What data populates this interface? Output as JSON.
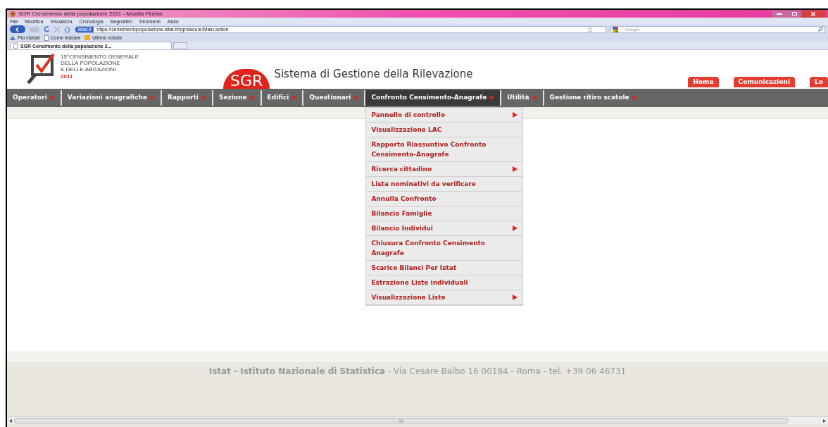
{
  "window": {
    "title": "SGR Censimento della popolazione 2011 - Mozilla Firefox"
  },
  "menu_bar": [
    "File",
    "Modifica",
    "Visualizza",
    "Cronologia",
    "Segnalibri",
    "Strumenti",
    "Aiuto"
  ],
  "address_bar": {
    "site_badge": "istat.it",
    "url": "https://censimentopopolazione.istat.it/sgr/secure/Main.action"
  },
  "search_field": {
    "placeholder": "Google"
  },
  "bookmarks": [
    "Più visitati",
    "Come iniziare",
    "Ultime notizie"
  ],
  "tabs": [
    {
      "label": "SGR Censimento della popolazione 2...",
      "selected": true
    }
  ],
  "header": {
    "logo_lines": [
      "15°CENSIMENTO GENERALE",
      "DELLA POPOLAZIONE",
      "E DELLE ABITAZIONI",
      "2011"
    ],
    "app_badge": "SGR",
    "app_title": "Sistema di Gestione della Rilevazione",
    "buttons": [
      "Home",
      "Comunicazioni",
      "Lo"
    ]
  },
  "nav": [
    {
      "label": "Operatori",
      "selected": false
    },
    {
      "label": "Variazioni anagrafiche",
      "selected": false
    },
    {
      "label": "Rapporti",
      "selected": false
    },
    {
      "label": "Sezione",
      "selected": false
    },
    {
      "label": "Edifici",
      "selected": false
    },
    {
      "label": "Questionari",
      "selected": false
    },
    {
      "label": "Confronto Censimento-Anagrafe",
      "selected": true
    },
    {
      "label": "Utilità",
      "selected": false
    },
    {
      "label": "Gestione ritiro scatole",
      "selected": false
    }
  ],
  "dropdown": [
    {
      "label": "Pannello di controllo",
      "submenu": true
    },
    {
      "label": "Visualizzazione LAC",
      "submenu": false
    },
    {
      "label": "Rapporto Riassuntivo Confronto Censimento-Anagrafe",
      "submenu": false
    },
    {
      "label": "Ricerca cittadino",
      "submenu": true
    },
    {
      "label": "Lista nominativi da verificare",
      "submenu": false
    },
    {
      "label": "Annulla Confronto",
      "submenu": false
    },
    {
      "label": "Bilancio Famiglie",
      "submenu": false
    },
    {
      "label": "Bilancio Individui",
      "submenu": true
    },
    {
      "label": "Chiusura Confronto Censimento Anagrafe",
      "submenu": false
    },
    {
      "label": "Scarico Bilanci Per Istat",
      "submenu": false
    },
    {
      "label": "Estrazione Liste individuali",
      "submenu": false
    },
    {
      "label": "Visualizzazione Liste",
      "submenu": true
    }
  ],
  "footer": "**Istat - Istituto Nazionale di Statistica** - Via Cesare Balbo 16 00184 - Roma - tel. +39 06 46731",
  "scrollbar_grip": "III"
}
